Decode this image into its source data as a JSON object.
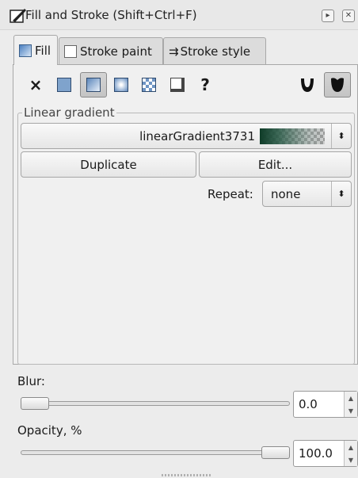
{
  "window": {
    "title": "Fill and Stroke (Shift+Ctrl+F)",
    "menu_icon": "play-icon",
    "close_icon": "close-icon"
  },
  "tabs": [
    {
      "label": "Fill",
      "active": true,
      "icon": "fill-icon"
    },
    {
      "label": "Stroke paint",
      "active": false,
      "icon": "stroke-paint-icon"
    },
    {
      "label": "Stroke style",
      "active": false,
      "icon": "stroke-style-icon"
    }
  ],
  "paint_types": [
    {
      "name": "no-paint",
      "glyph": "×"
    },
    {
      "name": "flat-color",
      "selected": false
    },
    {
      "name": "linear-gradient",
      "selected": true
    },
    {
      "name": "radial-gradient",
      "selected": false
    },
    {
      "name": "pattern",
      "selected": false
    },
    {
      "name": "swatch",
      "selected": false
    },
    {
      "name": "unset",
      "glyph": "?"
    }
  ],
  "fill_rule": {
    "evenodd_icon": "fill-rule-evenodd-icon",
    "nonzero_icon": "fill-rule-nonzero-icon",
    "selected": "nonzero"
  },
  "gradient": {
    "frame_label": "Linear gradient",
    "name": "linearGradient3731",
    "duplicate_label": "Duplicate",
    "edit_label": "Edit...",
    "repeat_label": "Repeat:",
    "repeat_value": "none"
  },
  "blur": {
    "label": "Blur:",
    "value": "0.0",
    "level": 0.0
  },
  "opacity": {
    "label": "Opacity, %",
    "value": "100.0",
    "level": 1.0
  },
  "colors": {
    "gradient_start": "#0f3c28",
    "panel_bg": "#f0f0f0"
  }
}
